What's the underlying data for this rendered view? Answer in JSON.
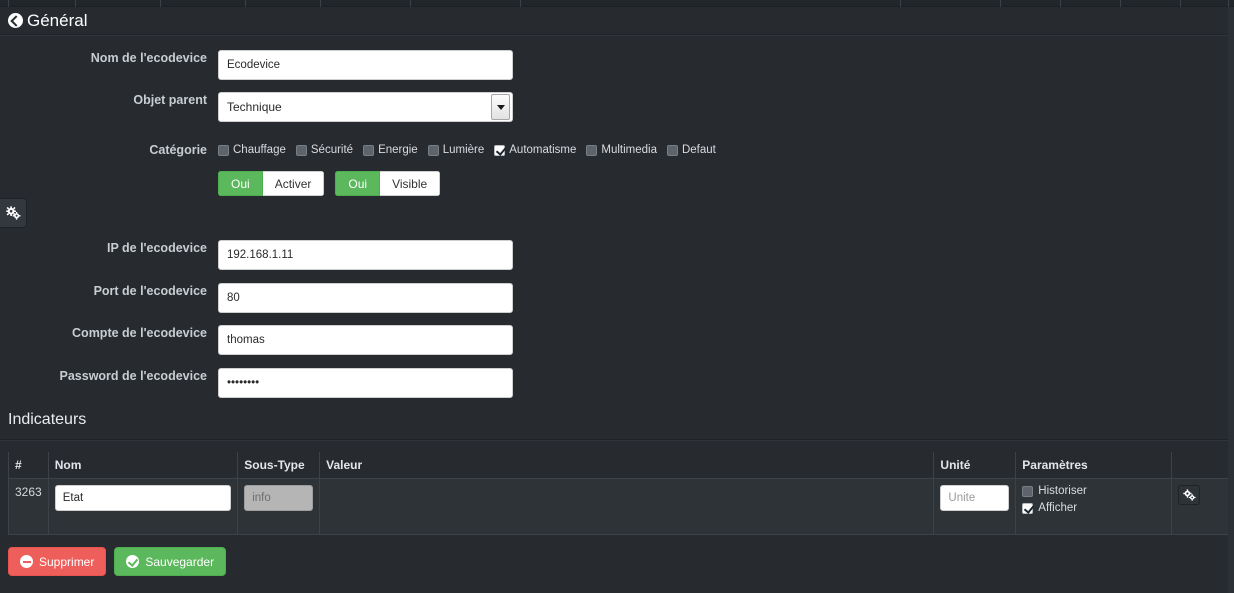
{
  "page": {
    "title": "Général",
    "back_icon": "back-arrow-circle-icon",
    "bg_color": "#272b30",
    "accent_green": "#5cb85c",
    "accent_red": "#ee5f5b"
  },
  "topbar": {
    "divider_positions": [
      8,
      75,
      160,
      245,
      320,
      410,
      520,
      900,
      1000,
      1060,
      1120,
      1180,
      1228
    ]
  },
  "side_tab": {
    "gear_icon": "gears-icon"
  },
  "form": {
    "fields": [
      {
        "label": "Nom de l'ecodevice",
        "value": "Ecodevice",
        "name": "ecodevice-name-input"
      },
      {
        "label": "IP de l'ecodevice",
        "value": "192.168.1.11",
        "name": "ecodevice-ip-input"
      },
      {
        "label": "Port de l'ecodevice",
        "value": "80",
        "name": "ecodevice-port-input"
      },
      {
        "label": "Compte de l'ecodevice",
        "value": "thomas",
        "name": "ecodevice-account-input"
      },
      {
        "label": "Password de l'ecodevice",
        "value": "••••••••",
        "name": "ecodevice-password-input"
      }
    ],
    "parent_object": {
      "label": "Objet parent",
      "selected": "Technique",
      "options": [
        "Technique"
      ],
      "chevron_icon": "chevron-down-icon"
    },
    "category": {
      "label": "Catégorie",
      "items": [
        {
          "label": "Chauffage",
          "checked": false
        },
        {
          "label": "Sécurité",
          "checked": false
        },
        {
          "label": "Energie",
          "checked": false
        },
        {
          "label": "Lumière",
          "checked": false
        },
        {
          "label": "Automatisme",
          "checked": true
        },
        {
          "label": "Multimedia",
          "checked": false
        },
        {
          "label": "Defaut",
          "checked": false
        }
      ]
    },
    "toggles": [
      {
        "on_label": "Oui",
        "off_label": "Activer",
        "state": "on"
      },
      {
        "on_label": "Oui",
        "off_label": "Visible",
        "state": "on"
      }
    ]
  },
  "indicators": {
    "title": "Indicateurs",
    "columns": [
      "#",
      "Nom",
      "Sous-Type",
      "Valeur",
      "Unité",
      "Paramètres",
      ""
    ],
    "rows": [
      {
        "id": "3263",
        "nom": "Etat",
        "sous_type": "info",
        "sous_type_disabled": true,
        "valeur": "",
        "unite_value": "",
        "unite_placeholder": "Unite",
        "parametres": [
          {
            "label": "Historiser",
            "checked": false
          },
          {
            "label": "Afficher",
            "checked": true
          }
        ],
        "action_icon": "gears-icon"
      }
    ]
  },
  "actions": {
    "delete": {
      "label": "Supprimer",
      "icon": "minus-circle-icon"
    },
    "save": {
      "label": "Sauvegarder",
      "icon": "check-circle-icon"
    }
  }
}
